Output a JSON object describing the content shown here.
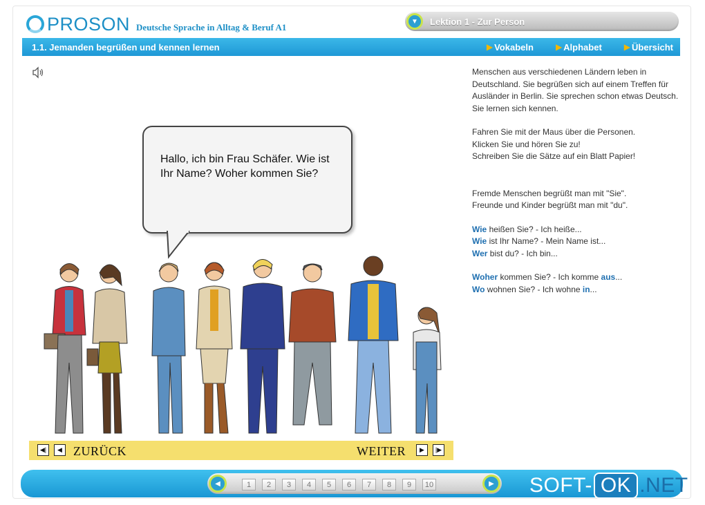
{
  "header": {
    "brand": "PROSON",
    "course_title": "Deutsche Sprache in Alltag & Beruf A1",
    "lesson_label": "Lektion 1 - Zur Person"
  },
  "titlebar": {
    "section_title": "1.1.  Jemanden begrüßen und kennen lernen",
    "links": [
      "Vokabeln",
      "Alphabet",
      "Übersicht"
    ]
  },
  "bubble": {
    "text": "Hallo, ich bin Frau Schäfer. Wie ist Ihr Name? Woher kommen Sie?"
  },
  "navigation": {
    "back_label": "ZURÜCK",
    "next_label": "WEITER"
  },
  "info": {
    "intro": "Menschen aus verschiedenen Ländern leben in Deutschland. Sie begrüßen sich auf einem Treffen für Ausländer in Berlin. Sie sprechen schon etwas Deutsch. Sie lernen sich kennen.",
    "instructions": [
      "Fahren Sie mit der Maus über die Personen.",
      "Klicken Sie und hören Sie zu!",
      "Schreiben Sie die Sätze auf ein Blatt Papier!"
    ],
    "note": [
      "Fremde Menschen begrüßt man mit \"Sie\".",
      "Freunde und Kinder begrüßt man mit \"du\"."
    ],
    "phrases_1": [
      {
        "kw": "Wie",
        "rest": " heißen Sie? - Ich heiße..."
      },
      {
        "kw": "Wie",
        "rest": " ist Ihr Name? - Mein Name ist..."
      },
      {
        "kw": "Wer",
        "rest": " bist du? - Ich bin..."
      }
    ],
    "phrase_woher": {
      "kw": "Woher",
      "mid": " kommen Sie? - Ich komme ",
      "kw2": "aus",
      "end": "..."
    },
    "phrase_wo": {
      "kw": "Wo",
      "mid": " wohnen Sie? - Ich wohne ",
      "kw2": "in",
      "end": "..."
    }
  },
  "pager": {
    "pages": [
      "1",
      "2",
      "3",
      "4",
      "5",
      "6",
      "7",
      "8",
      "9",
      "10"
    ]
  },
  "watermark": {
    "left": "SOFT-",
    "ok": "OK",
    "net": ".NET"
  },
  "colors": {
    "accent_blue": "#1e98d6",
    "yellow_bar": "#f5df6e",
    "keyword_blue": "#1e6fb0"
  }
}
